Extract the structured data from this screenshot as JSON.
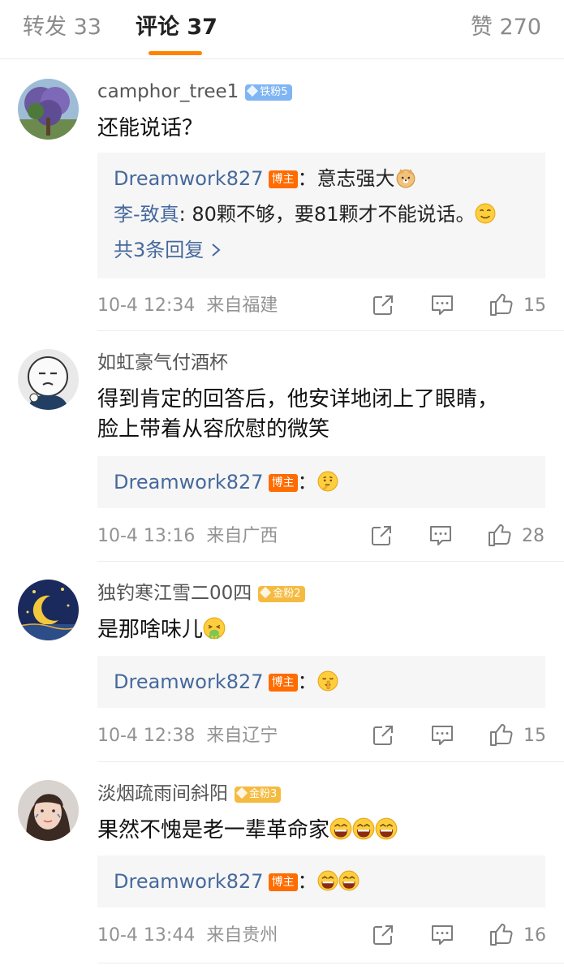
{
  "tabs": {
    "repost_label": "转发 33",
    "comment_label": "评论 37",
    "like_label": "赞 270"
  },
  "colors": {
    "accent": "#ff8200",
    "link": "#46699c",
    "bozhu_badge": "#ff6c00"
  },
  "comments": [
    {
      "username": "camphor_tree1",
      "fan_badge": "铁粉5",
      "text": "还能说话？",
      "replies": [
        {
          "name": "Dreamwork827",
          "is_author": true,
          "author_badge": "博主",
          "separator": "：",
          "text": "意志强大",
          "emoji": "doge-icon"
        },
        {
          "name": "李-致真",
          "is_author": false,
          "separator": ":",
          "text": " 80颗不够，要81颗才不能说话。",
          "emoji": "smirk-icon"
        }
      ],
      "more_replies": "共3条回复 ",
      "time": "10-4 12:34",
      "location": "来自福建",
      "likes": "15"
    },
    {
      "username": "如虹豪气付酒杯",
      "fan_badge": "",
      "text_line1": "得到肯定的回答后，他安详地闭上了眼睛，",
      "text_line2": "脸上带着从容欣慰的微笑",
      "replies": [
        {
          "name": "Dreamwork827",
          "is_author": true,
          "author_badge": "博主",
          "separator": "：",
          "text": "",
          "emoji": "thinking-icon"
        }
      ],
      "time": "10-4 13:16",
      "location": "来自广西",
      "likes": "28"
    },
    {
      "username": "独钓寒江雪二00四",
      "fan_badge": "金粉2",
      "text": "是那啥味儿",
      "emoji": "vomit-icon",
      "replies": [
        {
          "name": "Dreamwork827",
          "is_author": true,
          "author_badge": "博主",
          "separator": "：",
          "text": "",
          "emoji": "shush-icon"
        }
      ],
      "time": "10-4 12:38",
      "location": "来自辽宁",
      "likes": "15"
    },
    {
      "username": "淡烟疏雨间斜阳",
      "fan_badge": "金粉3",
      "text": "果然不愧是老一辈革命家",
      "emoji": "laugh-icon",
      "replies": [
        {
          "name": "Dreamwork827",
          "is_author": true,
          "author_badge": "博主",
          "separator": "：",
          "text": "",
          "emoji": "laugh-icon"
        }
      ],
      "time": "10-4 13:44",
      "location": "来自贵州",
      "likes": "16"
    }
  ]
}
